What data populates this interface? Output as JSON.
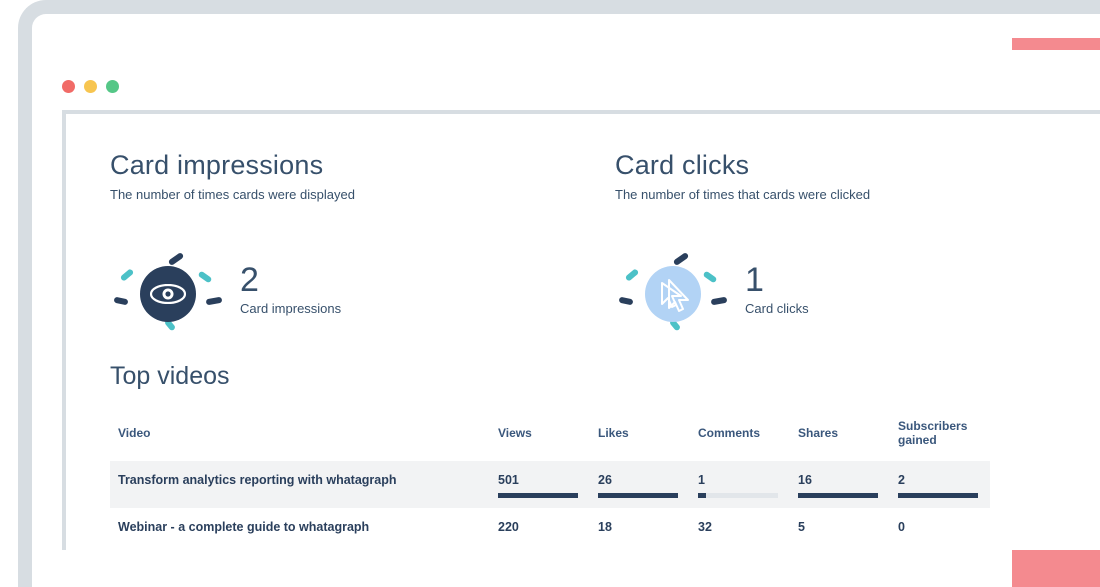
{
  "metrics": {
    "card_impressions": {
      "title": "Card impressions",
      "subtitle": "The number of times cards were displayed",
      "value": "2",
      "label": "Card impressions"
    },
    "card_clicks": {
      "title": "Card clicks",
      "subtitle": "The number of times that cards were clicked",
      "value": "1",
      "label": "Card clicks"
    }
  },
  "section_title": "Top videos",
  "table": {
    "headers": {
      "video": "Video",
      "views": "Views",
      "likes": "Likes",
      "comments": "Comments",
      "shares": "Shares",
      "subs": "Subscribers gained"
    },
    "rows": [
      {
        "video": "Transform analytics reporting with whatagraph",
        "views": "501",
        "likes": "26",
        "comments": "1",
        "shares": "16",
        "subs": "2",
        "bar_pct": {
          "views": 100,
          "likes": 100,
          "comments": 10,
          "shares": 100,
          "subs": 100
        }
      },
      {
        "video": "Webinar - a complete guide to whatagraph",
        "views": "220",
        "likes": "18",
        "comments": "32",
        "shares": "5",
        "subs": "0"
      }
    ]
  },
  "chart_data": {
    "type": "table",
    "title": "Top videos",
    "columns": [
      "Video",
      "Views",
      "Likes",
      "Comments",
      "Shares",
      "Subscribers gained"
    ],
    "rows": [
      [
        "Transform analytics reporting with whatagraph",
        501,
        26,
        1,
        16,
        2
      ],
      [
        "Webinar - a complete guide to whatagraph",
        220,
        18,
        32,
        5,
        0
      ]
    ],
    "summary_metrics": {
      "Card impressions": 2,
      "Card clicks": 1
    }
  }
}
